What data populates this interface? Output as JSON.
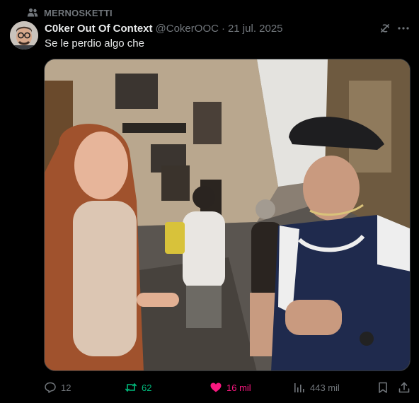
{
  "social_context": {
    "text": "MERNOSKETTI",
    "icon": "people-icon"
  },
  "author": {
    "display_name": "C0ker Out Of Context",
    "handle": "@CokerOOC",
    "separator": "·",
    "timestamp": "21 jul. 2025"
  },
  "tweet": {
    "text": "Se le perdio algo che"
  },
  "media": {
    "type": "video-still"
  },
  "actions": {
    "replies": "12",
    "reposts": "62",
    "likes": "16 mil",
    "views": "443 mil"
  },
  "colors": {
    "background": "#000000",
    "text_primary": "#e7e9ea",
    "text_secondary": "#71767b",
    "repost_active": "#00ba7c",
    "like_active": "#f91880"
  }
}
